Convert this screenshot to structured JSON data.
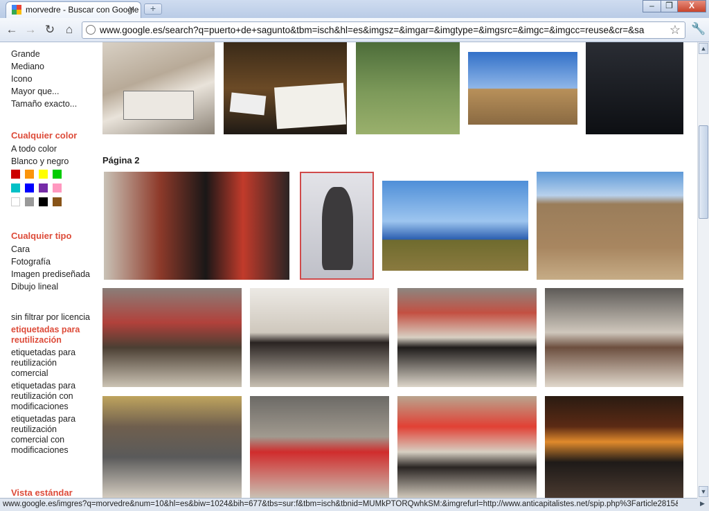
{
  "browser": {
    "tab_title": "morvedre - Buscar con Google",
    "tab_close": "✕",
    "new_tab": "+",
    "url": "www.google.es/search?q=puerto+de+sagunto&tbm=isch&hl=es&imgsz=&imgar=&imgtype=&imgsrc=&imgc=&imgcc=reuse&cr=&sa",
    "window_minimize": "–",
    "window_restore": "❐",
    "window_close": "X",
    "nav_back": "←",
    "nav_forward": "→",
    "nav_reload": "↻",
    "nav_home": "⌂",
    "star": "☆",
    "wrench": "🔧"
  },
  "sidebar": {
    "size_items": [
      "Grande",
      "Mediano",
      "Icono",
      "Mayor que...",
      "Tamaño exacto..."
    ],
    "color_head": "Cualquier color",
    "color_items": [
      "A todo color",
      "Blanco y negro"
    ],
    "swatches": [
      "#cc0000",
      "#fb940b",
      "#ffff00",
      "#00cc00",
      "#03c0c6",
      "#0000ff",
      "#762ca7",
      "#ff98bf",
      "#ffffff",
      "#999999",
      "#000000",
      "#885418"
    ],
    "type_head": "Cualquier tipo",
    "type_items": [
      "Cara",
      "Fotografía",
      "Imagen prediseñada",
      "Dibujo lineal"
    ],
    "license_items": [
      {
        "text": "sin filtrar por licencia",
        "selected": false
      },
      {
        "text": "etiquetadas para reutilización",
        "selected": true
      },
      {
        "text": "etiquetadas para reutilización comercial",
        "selected": false
      },
      {
        "text": "etiquetadas para reutilización con modificaciones",
        "selected": false
      },
      {
        "text": "etiquetadas para reutilización comercial con modificaciones",
        "selected": false
      }
    ],
    "view_head": "Vista estándar"
  },
  "results": {
    "page_label": "Página 2"
  },
  "status": {
    "url": "www.google.es/imgres?q=morvedre&num=10&hl=es&biw=1024&bih=677&tbs=sur:f&tbm=isch&tbnid=MUMkPTORQwhkSM:&imgrefurl=http://www.anticapitalistes.net/spip.php%3Farticle2815&docid=jf..."
  },
  "scroll": {
    "up": "▲",
    "down": "▼",
    "right": "▶"
  }
}
